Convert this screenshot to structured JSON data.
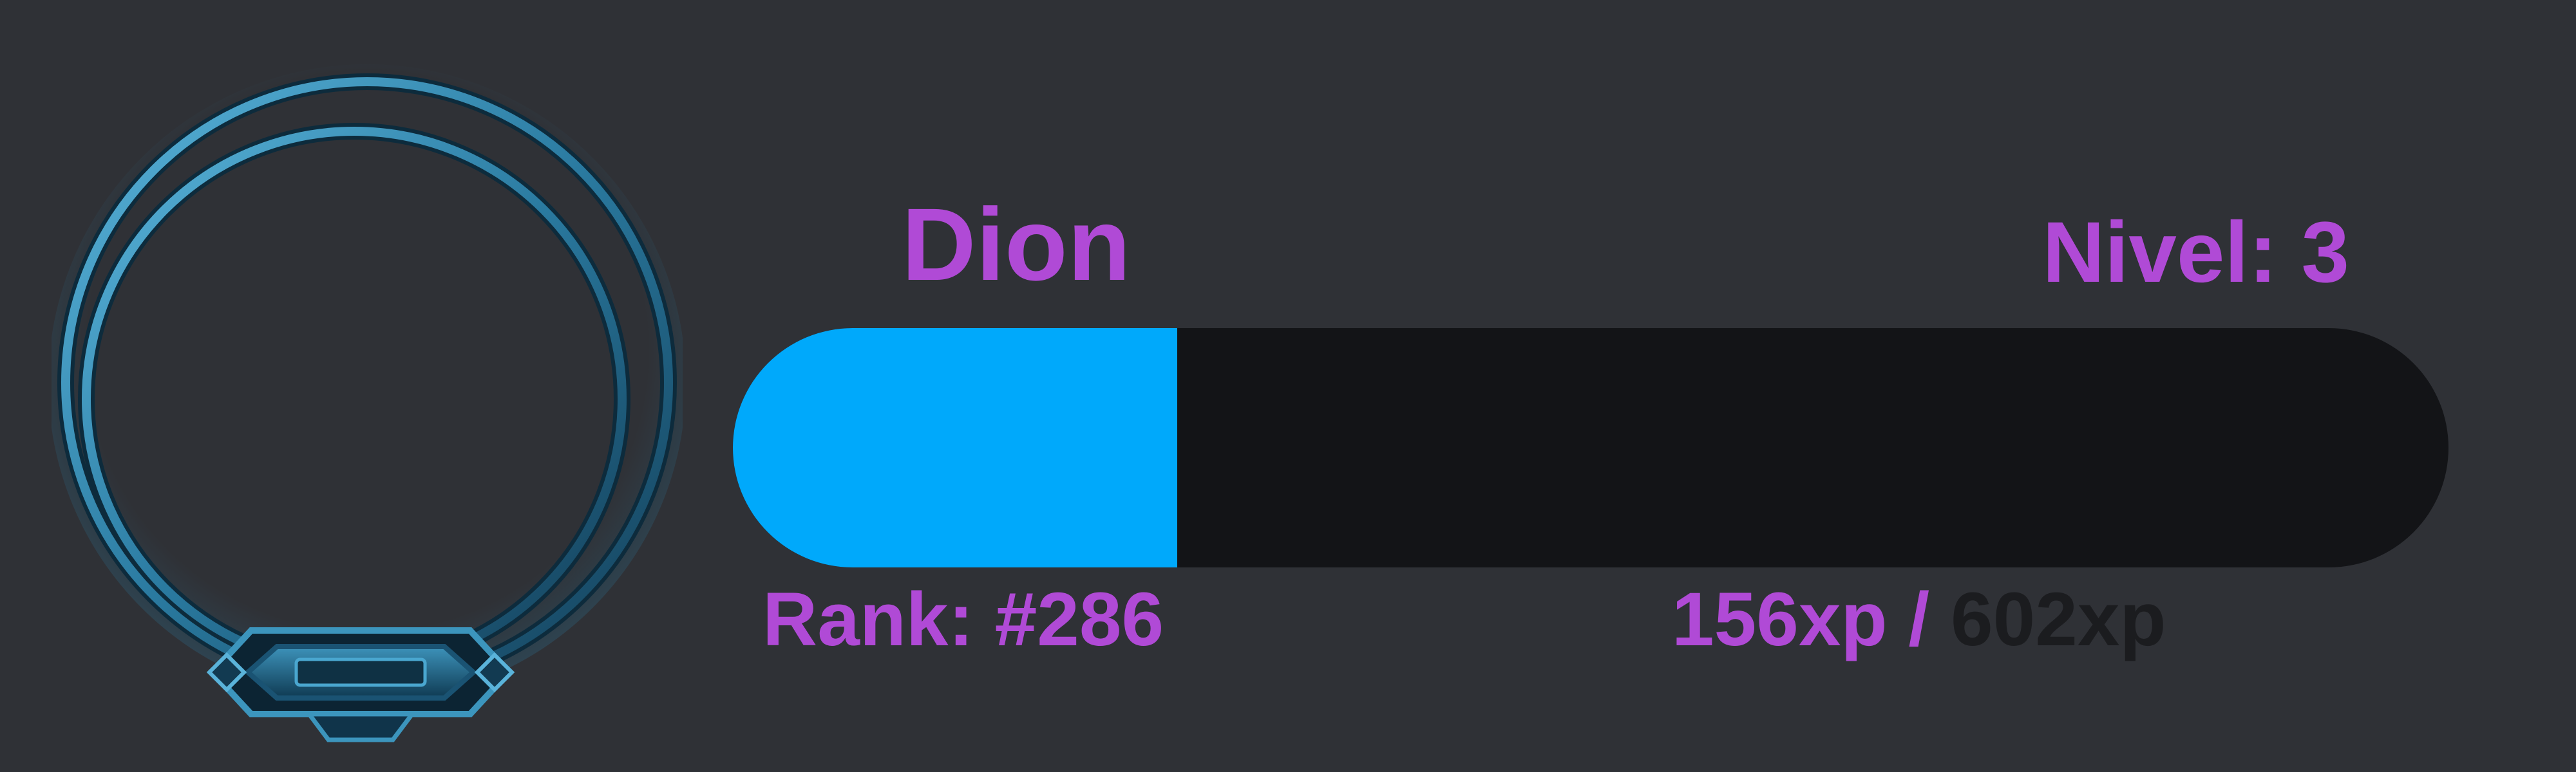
{
  "colors": {
    "background": "#2f3136",
    "accent_text": "#b04ad6",
    "bar_track": "#131417",
    "bar_fill": "#00a9fb",
    "max_xp_text": "#1b1c1f",
    "frame": "#2b7ea5"
  },
  "user": {
    "name": "Dion",
    "level_text": "Nivel: 3",
    "rank_text": "Rank: #286"
  },
  "xp": {
    "current_text": "156xp",
    "separator": " / ",
    "max_text": "602xp",
    "current": 156,
    "max": 602,
    "progress_fraction": 0.2591
  },
  "avatar": {
    "frame_icon": "ring-frame-icon"
  }
}
